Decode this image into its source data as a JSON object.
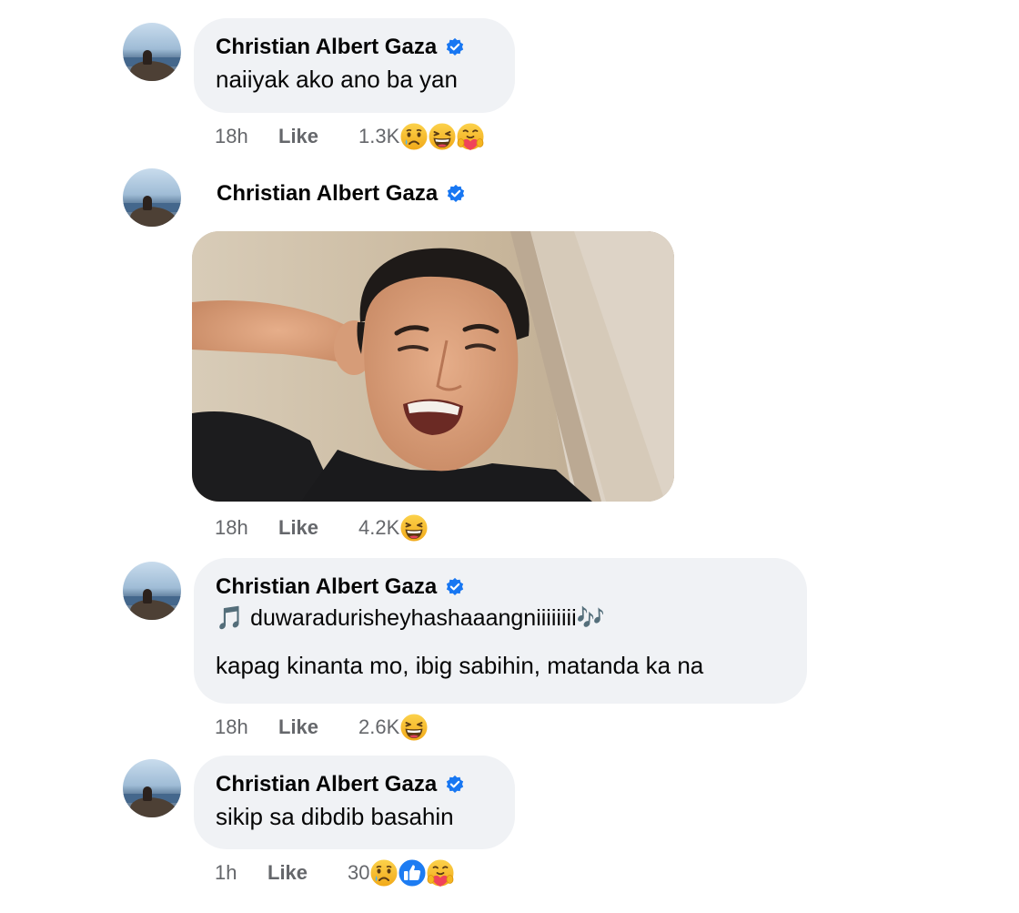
{
  "comments": [
    {
      "author": "Christian Albert Gaza",
      "verified_icon": "verified-badge-icon",
      "text": "naiiyak ako ano ba yan",
      "time": "18h",
      "like_label": "Like",
      "reaction_count": "1.3K",
      "reactions": [
        "sad-face-icon",
        "laughing-face-icon",
        "care-face-icon"
      ]
    },
    {
      "author": "Christian Albert Gaza",
      "verified_icon": "verified-badge-icon",
      "media": "photo-of-man-crying",
      "time": "18h",
      "like_label": "Like",
      "reaction_count": "4.2K",
      "reactions": [
        "laughing-face-icon"
      ]
    },
    {
      "author": "Christian Albert Gaza",
      "verified_icon": "verified-badge-icon",
      "text_line1": "🎵 duwaradurisheyhashaaangniiiiiiii🎶",
      "text_line2": "kapag kinanta mo, ibig sabihin, matanda ka na",
      "time": "18h",
      "like_label": "Like",
      "reaction_count": "2.6K",
      "reactions": [
        "laughing-face-icon"
      ]
    },
    {
      "author": "Christian Albert Gaza",
      "verified_icon": "verified-badge-icon",
      "text": "sikip sa dibdib basahin",
      "time": "1h",
      "like_label": "Like",
      "reaction_count": "30",
      "reactions": [
        "sad-face-icon",
        "like-thumb-icon",
        "care-face-icon"
      ]
    }
  ],
  "colors": {
    "bubble_bg": "#f0f2f5",
    "verified_blue": "#1877f2",
    "meta_gray": "#65676b",
    "emoji_yellow": "#f7c53b"
  }
}
